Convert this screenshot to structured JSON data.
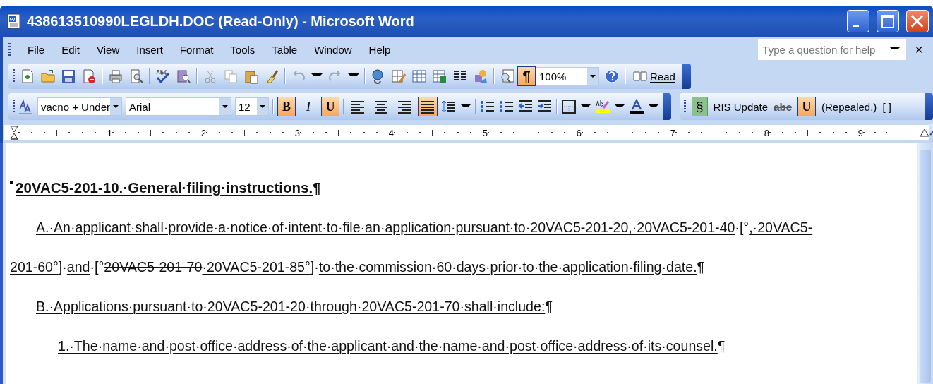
{
  "window": {
    "title": "438613510990LEGLDH.DOC (Read-Only) - Microsoft Word"
  },
  "menu": {
    "items": [
      "File",
      "Edit",
      "View",
      "Insert",
      "Format",
      "Tools",
      "Table",
      "Window",
      "Help"
    ],
    "help_placeholder": "Type a question for help",
    "close": "×"
  },
  "standard_toolbar": {
    "show_marks": {
      "label": "¶",
      "selected": true
    },
    "zoom": "100%",
    "read": "Read"
  },
  "formatting_toolbar": {
    "style": "vacno + Under",
    "font": "Arial",
    "size": "12",
    "format_buttons": [
      {
        "label": "B",
        "selected": true
      },
      {
        "label": "I",
        "selected": false
      },
      {
        "label": "U",
        "selected": true
      }
    ],
    "align_buttons": [
      {
        "selected": false
      },
      {
        "selected": false
      },
      {
        "selected": false
      },
      {
        "selected": true
      }
    ]
  },
  "ris_toolbar": {
    "section": "§",
    "update": "RIS Update",
    "strike": "abc",
    "underline": {
      "label": "U",
      "selected": true
    },
    "repealed": "(Repealed.)",
    "brackets": "[ ]"
  },
  "ruler": {
    "numbers": [
      "1",
      "2",
      "3",
      "4",
      "5",
      "6",
      "7",
      "8",
      "9"
    ]
  },
  "document": {
    "lines": [
      {
        "kind": "heading",
        "segments": [
          {
            "text": "20VAC5-201-10.·General·filing·instructions.",
            "kind": "inserted"
          },
          {
            "text": "¶",
            "kind": "plain"
          }
        ]
      },
      {
        "kind": "first",
        "segments": [
          {
            "text": "A.·An·applicant·shall·provide·a·notice·of·intent·to·file·an·application·pursuant·to·20VAC5-201-20,·20VAC5-201-40",
            "kind": "inserted"
          },
          {
            "text": "·[°",
            "kind": "plain"
          },
          {
            "text": ",·20VAC5-",
            "kind": "inserted"
          }
        ]
      },
      {
        "kind": "continued",
        "segments": [
          {
            "text": "201-60°",
            "kind": "inserted"
          },
          {
            "text": "]·",
            "kind": "plain"
          },
          {
            "text": "and",
            "kind": "inserted"
          },
          {
            "text": "·[°",
            "kind": "plain"
          },
          {
            "text": "20VAC5-201-70",
            "kind": "deleted"
          },
          {
            "text": "·20VAC5-201-85°",
            "kind": "inserted"
          },
          {
            "text": "]·",
            "kind": "plain"
          },
          {
            "text": "to·the·commission·60·days·prior·to·the·application·filing·date.",
            "kind": "inserted"
          },
          {
            "text": "¶",
            "kind": "plain"
          }
        ]
      },
      {
        "kind": "first",
        "segments": [
          {
            "text": "B.·Applications·pursuant·to·20VAC5-201-20·through·20VAC5-201-70·shall·include:",
            "kind": "inserted"
          },
          {
            "text": "¶",
            "kind": "plain"
          }
        ]
      },
      {
        "kind": "item",
        "segments": [
          {
            "text": "1.·The·name·and·post·office·address·of·the·applicant·and·the·name·and·post·office·address·of·its·counsel.",
            "kind": "inserted"
          },
          {
            "text": "¶",
            "kind": "plain"
          }
        ]
      }
    ]
  }
}
